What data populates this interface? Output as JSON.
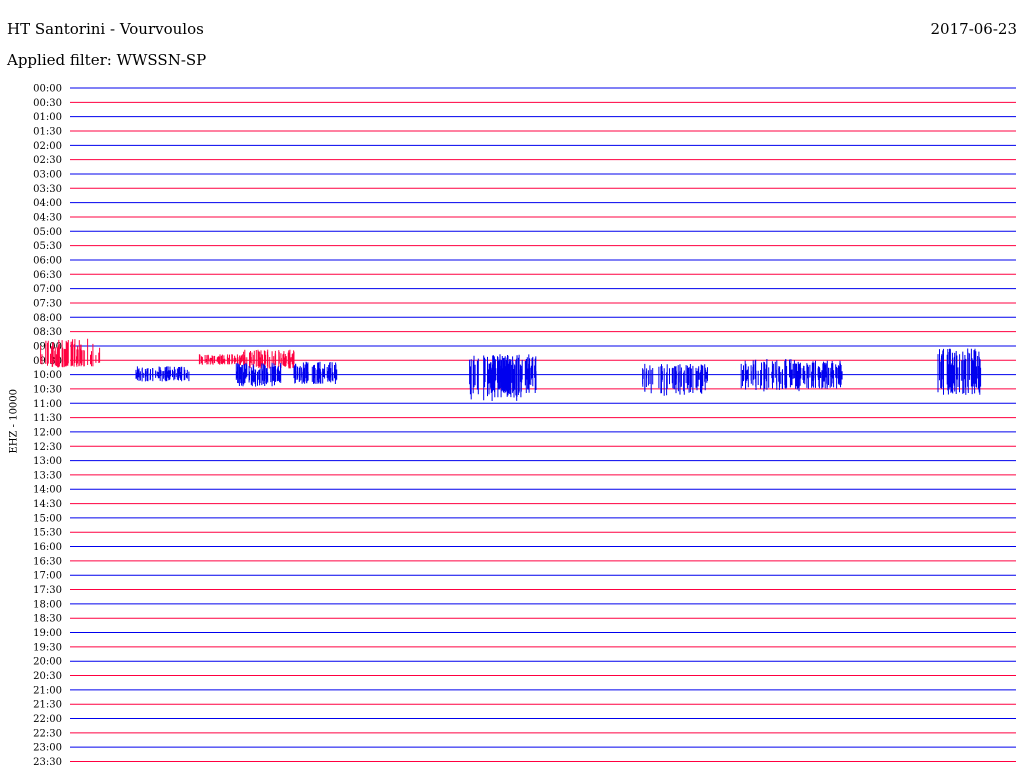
{
  "header": {
    "station": "HT Santorini - Vourvoulos",
    "date": "2017-06-23",
    "filter": "Applied filter: WWSSN-SP"
  },
  "chart_data": {
    "type": "line",
    "title": "HT Santorini - Vourvoulos",
    "subtitle": "Applied filter: WWSSN-SP",
    "ylabel": "EHZ - 10000",
    "xlabel": "",
    "grid": false,
    "trace_colors": [
      "#0000ee",
      "#ff0040"
    ],
    "row_labels": [
      "00:00",
      "00:30",
      "01:00",
      "01:30",
      "02:00",
      "02:30",
      "03:00",
      "03:30",
      "04:00",
      "04:30",
      "05:00",
      "05:30",
      "06:00",
      "06:30",
      "07:00",
      "07:30",
      "08:00",
      "08:30",
      "09:00",
      "09:30",
      "10:00",
      "10:30",
      "11:00",
      "11:30",
      "12:00",
      "12:30",
      "13:00",
      "13:30",
      "14:00",
      "14:30",
      "15:00",
      "15:30",
      "16:00",
      "16:30",
      "17:00",
      "17:30",
      "18:00",
      "18:30",
      "19:00",
      "19:30",
      "20:00",
      "20:30",
      "21:00",
      "21:30",
      "22:00",
      "22:30",
      "23:00",
      "23:30"
    ],
    "events": [
      {
        "row": 19,
        "x": 0.0,
        "up": 18,
        "down": 6
      },
      {
        "row": 19,
        "x": 0.16,
        "up": 5,
        "down": 4
      },
      {
        "row": 19,
        "x": 0.21,
        "up": 9,
        "down": 7
      },
      {
        "row": 20,
        "x": 0.1,
        "up": 7,
        "down": 6
      },
      {
        "row": 20,
        "x": 0.2,
        "up": 10,
        "down": 10
      },
      {
        "row": 20,
        "x": 0.26,
        "up": 11,
        "down": 8
      },
      {
        "row": 20,
        "x": 0.45,
        "up": 16,
        "down": 22
      },
      {
        "row": 20,
        "x": 0.47,
        "up": 17,
        "down": 16
      },
      {
        "row": 20,
        "x": 0.64,
        "up": 9,
        "down": 18
      },
      {
        "row": 20,
        "x": 0.74,
        "up": 13,
        "down": 14
      },
      {
        "row": 20,
        "x": 0.79,
        "up": 12,
        "down": 12
      },
      {
        "row": 20,
        "x": 0.94,
        "up": 22,
        "down": 17
      }
    ]
  }
}
